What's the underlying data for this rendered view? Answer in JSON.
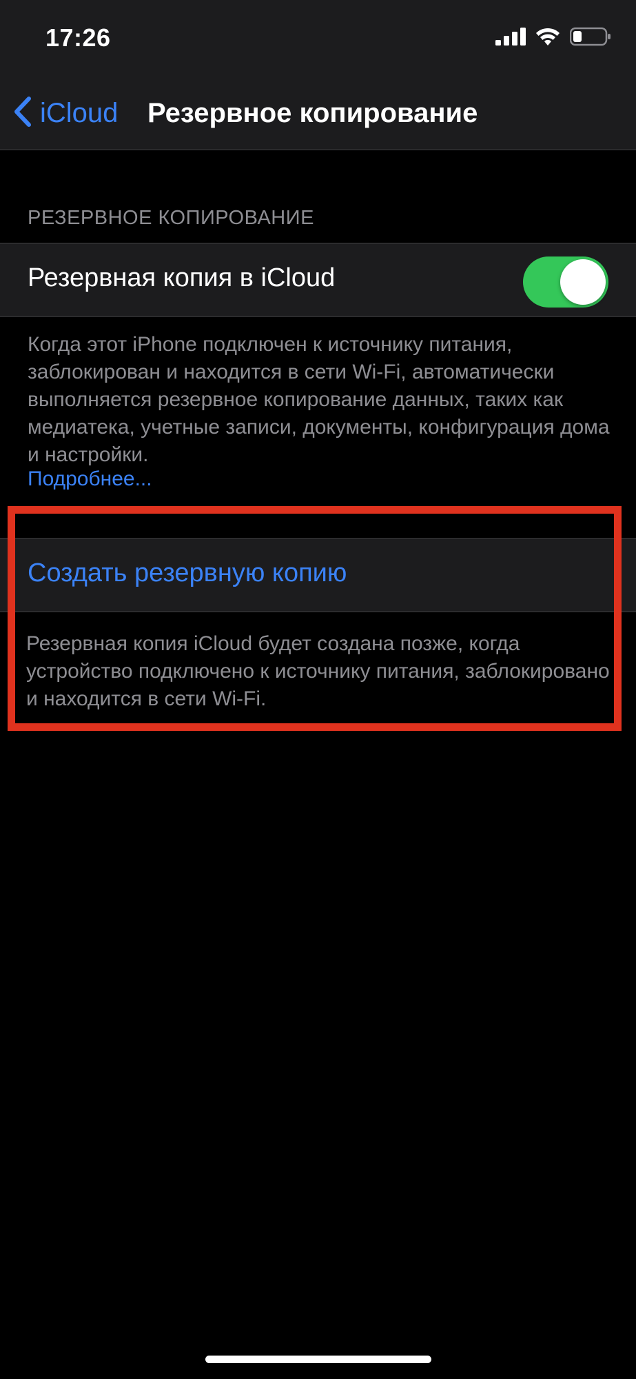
{
  "status_bar": {
    "time": "17:26",
    "icons": [
      "cellular-signal-icon",
      "wifi-icon",
      "battery-icon"
    ]
  },
  "nav": {
    "back_label": "iCloud",
    "title": "Резервное копирование"
  },
  "backup_section": {
    "header": "РЕЗЕРВНОЕ КОПИРОВАНИЕ",
    "toggle_label": "Резервная копия в iCloud",
    "toggle_on": true,
    "footer": "Когда этот iPhone подключен к источнику питания, заблокирован и находится в сети Wi-Fi, автоматически выполняется резервное копирование данных, таких как медиатека, учетные записи, документы, конфигурация дома и настройки.",
    "more_link": "Подробнее..."
  },
  "create_section": {
    "button_label": "Создать резервную копию",
    "footer": "Резервная копия iCloud будет создана позже, когда устройство подключено к источнику питания, заблокировано и находится в сети Wi-Fi."
  },
  "colors": {
    "accent": "#3b82f6",
    "toggle_on": "#34c759",
    "highlight": "#e0321e",
    "background": "#000000",
    "cell": "#1c1c1e",
    "secondary_text": "#8e8e93"
  }
}
